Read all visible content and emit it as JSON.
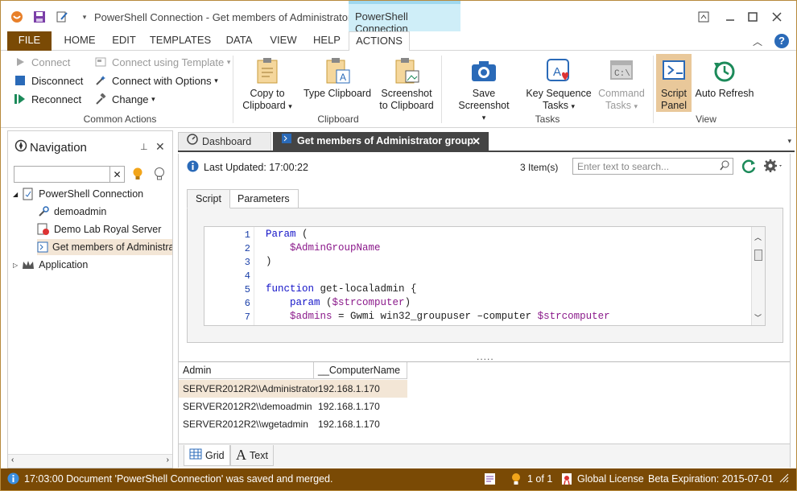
{
  "window": {
    "title": "PowerShell Connection - Get members of Administrator g...",
    "context_tab": "PowerShell Connection"
  },
  "ribbon_tabs": [
    "FILE",
    "HOME",
    "EDIT",
    "TEMPLATES",
    "DATA",
    "VIEW",
    "HELP",
    "ACTIONS"
  ],
  "ribbon": {
    "common_actions": {
      "label": "Common Actions",
      "connect": "Connect",
      "connect_template": "Connect using Template",
      "disconnect": "Disconnect",
      "connect_options": "Connect with Options",
      "reconnect": "Reconnect",
      "change": "Change"
    },
    "clipboard": {
      "label": "Clipboard",
      "copy_l1": "Copy to",
      "copy_l2": "Clipboard",
      "type_l1": "Type Clipboard",
      "screenshot_l1": "Screenshot",
      "screenshot_l2": "to Clipboard"
    },
    "tasks": {
      "label": "Tasks",
      "save_screenshot": "Save Screenshot",
      "key_l1": "Key Sequence",
      "key_l2": "Tasks",
      "cmd_l1": "Command",
      "cmd_l2": "Tasks"
    },
    "view": {
      "label": "View",
      "script_l1": "Script",
      "script_l2": "Panel",
      "auto_refresh": "Auto Refresh"
    }
  },
  "navigation": {
    "title": "Navigation",
    "tree": [
      "PowerShell Connection",
      "demoadmin",
      "Demo Lab Royal Server",
      "Get members of Administrators group",
      "Application"
    ]
  },
  "doc_tabs": [
    "Dashboard",
    "Get members of Administrator group"
  ],
  "content": {
    "last_updated": "Last Updated: 17:00:22",
    "item_count": "3 Item(s)",
    "search_placeholder": "Enter text to search...",
    "subtabs": [
      "Script",
      "Parameters"
    ],
    "line_numbers": [
      "1",
      "2",
      "3",
      "4",
      "5",
      "6",
      "7"
    ],
    "code": {
      "l1_kw": "Param",
      "l1_rest": " (",
      "l2_var": "$AdminGroupName",
      "l3": ")",
      "l5_kw": "function",
      "l5_rest": " get-localadmin {",
      "l6_kw": "param",
      "l6_p1": " (",
      "l6_var": "$strcomputer",
      "l6_p2": ")",
      "l7_var1": "$admins",
      "l7_mid": " = Gwmi win32_groupuser –computer ",
      "l7_var2": "$strcomputer"
    },
    "splitter": ".....",
    "grid": {
      "columns": [
        "Admin",
        "__ComputerName"
      ],
      "rows": [
        [
          "SERVER2012R2\\\\Administrator",
          "192.168.1.170"
        ],
        [
          "SERVER2012R2\\\\demoadmin",
          "192.168.1.170"
        ],
        [
          "SERVER2012R2\\\\wgetadmin",
          "192.168.1.170"
        ]
      ]
    },
    "bottom_tabs": [
      "Grid",
      "Text"
    ]
  },
  "status": {
    "message": "17:03:00 Document 'PowerShell Connection' was saved and merged.",
    "page": "1 of 1",
    "license": "Global License",
    "expiration": "Beta Expiration: 2015-07-01"
  }
}
